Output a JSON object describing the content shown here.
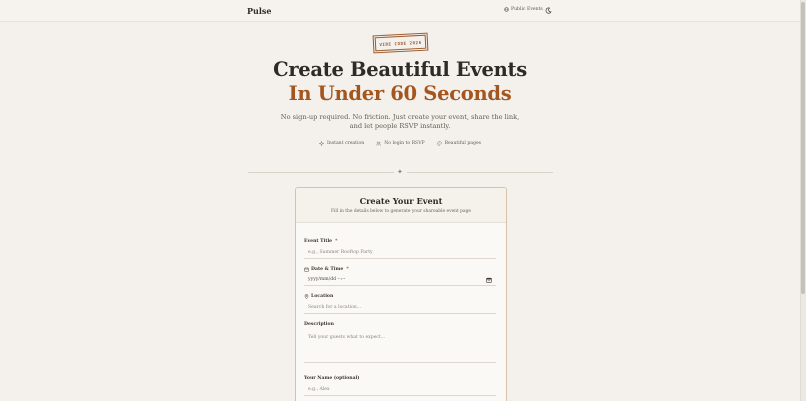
{
  "header": {
    "brand": "Pulse",
    "public_events": "Public Events"
  },
  "stamp": "VIBE CODE 2026",
  "hero": {
    "line1": "Create Beautiful Events",
    "line2": "In Under 60 Seconds",
    "subtitle_line1": "No sign-up required. No friction. Just create your event, share the link,",
    "subtitle_line2": "and let people RSVP instantly."
  },
  "features": [
    {
      "label": "Instant creation",
      "icon": "sparkle-icon"
    },
    {
      "label": "No login to RSVP",
      "icon": "users-icon"
    },
    {
      "label": "Beautiful pages",
      "icon": "palette-icon"
    }
  ],
  "divider_mark": "✦",
  "form": {
    "title": "Create Your Event",
    "subtitle": "Fill in the details below to generate your shareable event page",
    "event_title": {
      "label": "Event Title",
      "required": "*",
      "placeholder": "e.g., Summer Rooftop Party"
    },
    "date_time": {
      "label": "Date & Time",
      "required": "*",
      "placeholder": "yyyy/mm/dd --:--"
    },
    "location": {
      "label": "Location",
      "placeholder": "Search for a location..."
    },
    "description": {
      "label": "Description",
      "placeholder": "Tell your guests what to expect..."
    },
    "your_name": {
      "label": "Your Name (optional)",
      "placeholder": "e.g., Alex"
    }
  },
  "colors": {
    "accent": "#a4561f",
    "background": "#f4f1ec",
    "text": "#2e2a25"
  }
}
